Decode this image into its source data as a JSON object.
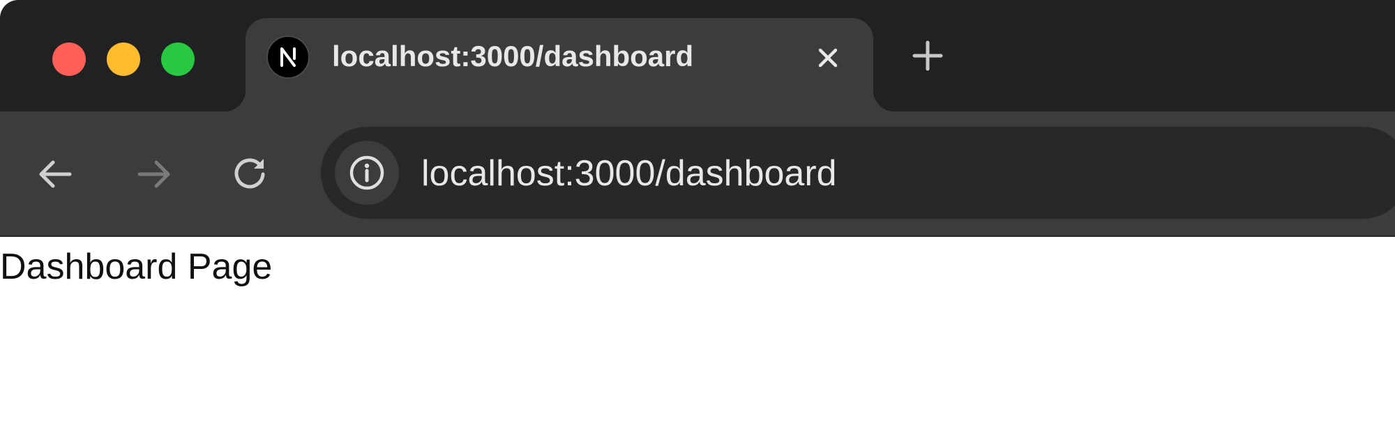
{
  "window": {
    "traffic_lights": {
      "close_color": "#ff5f57",
      "minimize_color": "#febc2e",
      "maximize_color": "#28c840"
    }
  },
  "tab": {
    "title": "localhost:3000/dashboard",
    "favicon": "nextjs-logo-icon",
    "close_icon": "close-icon"
  },
  "new_tab_icon": "plus-icon",
  "toolbar": {
    "back_icon": "arrow-left-icon",
    "forward_icon": "arrow-right-icon",
    "reload_icon": "reload-icon",
    "site_info_icon": "info-icon",
    "url": "localhost:3000/dashboard"
  },
  "page": {
    "heading": "Dashboard Page"
  }
}
